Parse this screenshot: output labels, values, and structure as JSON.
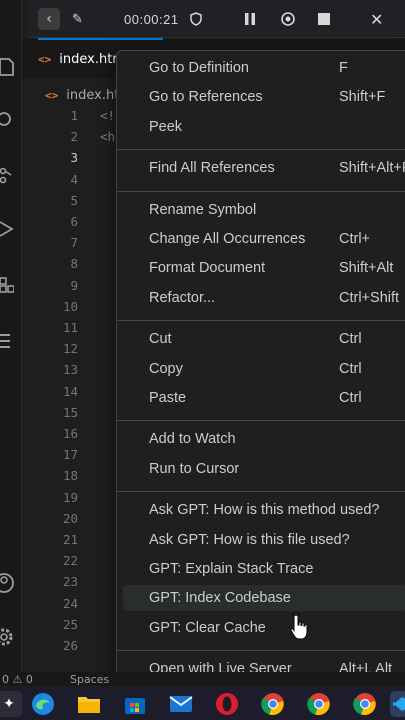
{
  "recorder": {
    "elapsed": "00:00:21"
  },
  "tab": {
    "file_name": "index.html"
  },
  "breadcrumb": {
    "file_name": "index.html"
  },
  "editor": {
    "line_numbers": [
      "1",
      "2",
      "3",
      "4",
      "5",
      "6",
      "7",
      "8",
      "9",
      "10",
      "11",
      "12",
      "13",
      "14",
      "15",
      "16",
      "17",
      "18",
      "19",
      "20",
      "21",
      "22",
      "23",
      "24",
      "25",
      "26"
    ],
    "current_line": "3",
    "code_lines": [
      "<!",
      "<h"
    ]
  },
  "context_menu": {
    "groups": [
      [
        {
          "label": "Go to Definition",
          "shortcut": "F"
        },
        {
          "label": "Go to References",
          "shortcut": "Shift+F"
        },
        {
          "label": "Peek",
          "shortcut": ""
        }
      ],
      [
        {
          "label": "Find All References",
          "shortcut": "Shift+Alt+F"
        }
      ],
      [
        {
          "label": "Rename Symbol",
          "shortcut": ""
        },
        {
          "label": "Change All Occurrences",
          "shortcut": "Ctrl+"
        },
        {
          "label": "Format Document",
          "shortcut": "Shift+Alt"
        },
        {
          "label": "Refactor...",
          "shortcut": "Ctrl+Shift"
        }
      ],
      [
        {
          "label": "Cut",
          "shortcut": "Ctrl"
        },
        {
          "label": "Copy",
          "shortcut": "Ctrl"
        },
        {
          "label": "Paste",
          "shortcut": "Ctrl"
        }
      ],
      [
        {
          "label": "Add to Watch",
          "shortcut": ""
        },
        {
          "label": "Run to Cursor",
          "shortcut": ""
        }
      ],
      [
        {
          "label": "Ask GPT: How is this method used?",
          "shortcut": ""
        },
        {
          "label": "Ask GPT: How is this file used?",
          "shortcut": ""
        },
        {
          "label": "GPT: Explain Stack Trace",
          "shortcut": ""
        },
        {
          "label": "GPT: Index Codebase",
          "shortcut": ""
        },
        {
          "label": "GPT: Clear Cache",
          "shortcut": ""
        }
      ],
      [
        {
          "label": "Open with Live Server",
          "shortcut": "Alt+L Alt"
        }
      ]
    ],
    "hovered_item": "GPT: Index Codebase"
  },
  "status_bar": {
    "left_text": "0 ⚠ 0",
    "spaces_text": "Spaces"
  },
  "colors": {
    "accent": "#0078d4",
    "html_icon": "#e37933",
    "menu_bg": "#1f1f1f",
    "editor_bg": "#1e1e1e"
  }
}
